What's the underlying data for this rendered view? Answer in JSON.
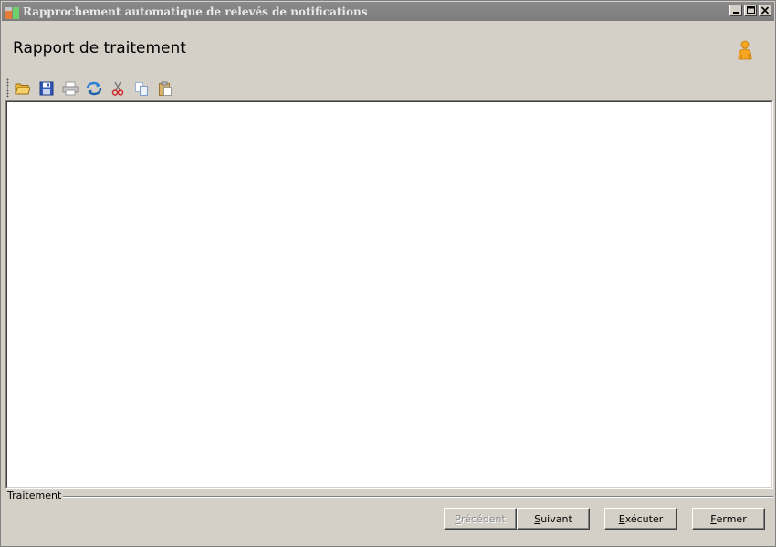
{
  "window": {
    "title": "Rapprochement automatique de relevés de notifications",
    "controls": [
      "minimize-icon",
      "maximize-icon",
      "close-icon"
    ]
  },
  "header": {
    "title": "Rapport de traitement",
    "icon": "user-icon"
  },
  "toolbar": {
    "items": [
      {
        "name": "open",
        "icon": "folder-open-icon"
      },
      {
        "name": "save",
        "icon": "floppy-save-icon"
      },
      {
        "name": "print",
        "icon": "printer-icon"
      },
      {
        "name": "refresh",
        "icon": "refresh-icon"
      },
      {
        "name": "cut",
        "icon": "scissors-cut-icon"
      },
      {
        "name": "copy",
        "icon": "copy-icon"
      },
      {
        "name": "paste",
        "icon": "paste-icon"
      }
    ]
  },
  "content": {
    "text": ""
  },
  "group": {
    "label": "Traitement"
  },
  "buttons": {
    "previous": {
      "first": "P",
      "rest": "récédent",
      "enabled": false
    },
    "next": {
      "first": "S",
      "rest": "uivant",
      "enabled": true
    },
    "execute": {
      "first": "E",
      "rest": "xécuter",
      "enabled": true
    },
    "close": {
      "first": "F",
      "rest": "ermer",
      "enabled": true
    }
  },
  "colors": {
    "titlebar": "#808080",
    "face": "#d4d0c8",
    "content": "#ffffff"
  }
}
